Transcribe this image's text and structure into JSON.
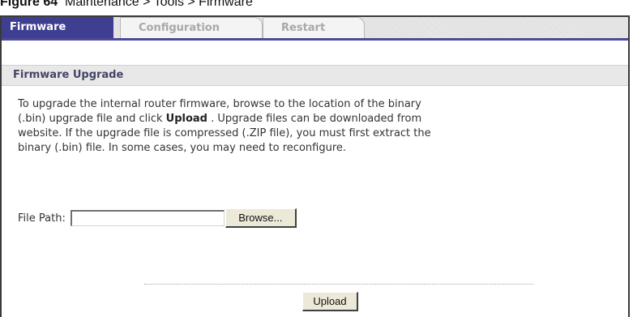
{
  "caption": {
    "figure_label": "Figure 64",
    "text": "Maintenance > Tools > Firmware"
  },
  "tabs": [
    {
      "label": "Firmware",
      "active": true
    },
    {
      "label": "Configuration",
      "active": false
    },
    {
      "label": "Restart",
      "active": false
    }
  ],
  "section": {
    "title": "Firmware Upgrade"
  },
  "description": {
    "line1": "To upgrade the internal router firmware, browse to the location of the binary",
    "line2_pre": "(.bin) upgrade file and click ",
    "line2_bold": "Upload",
    "line2_post": " . Upgrade files can be downloaded from",
    "line3": "website. If the upgrade file is compressed (.ZIP file), you must first extract the",
    "line4": "binary (.bin) file. In some cases, you may need to reconfigure."
  },
  "file_path": {
    "label": "File Path:",
    "value": "",
    "browse_label": "Browse..."
  },
  "upload_label": "Upload",
  "colors": {
    "active_tab_bg": "#3f3f92",
    "active_tab_text": "#ffffff",
    "inactive_tab_text": "#a8a8a8",
    "section_bg": "#e8e8e8",
    "button_face": "#ece9d8"
  }
}
